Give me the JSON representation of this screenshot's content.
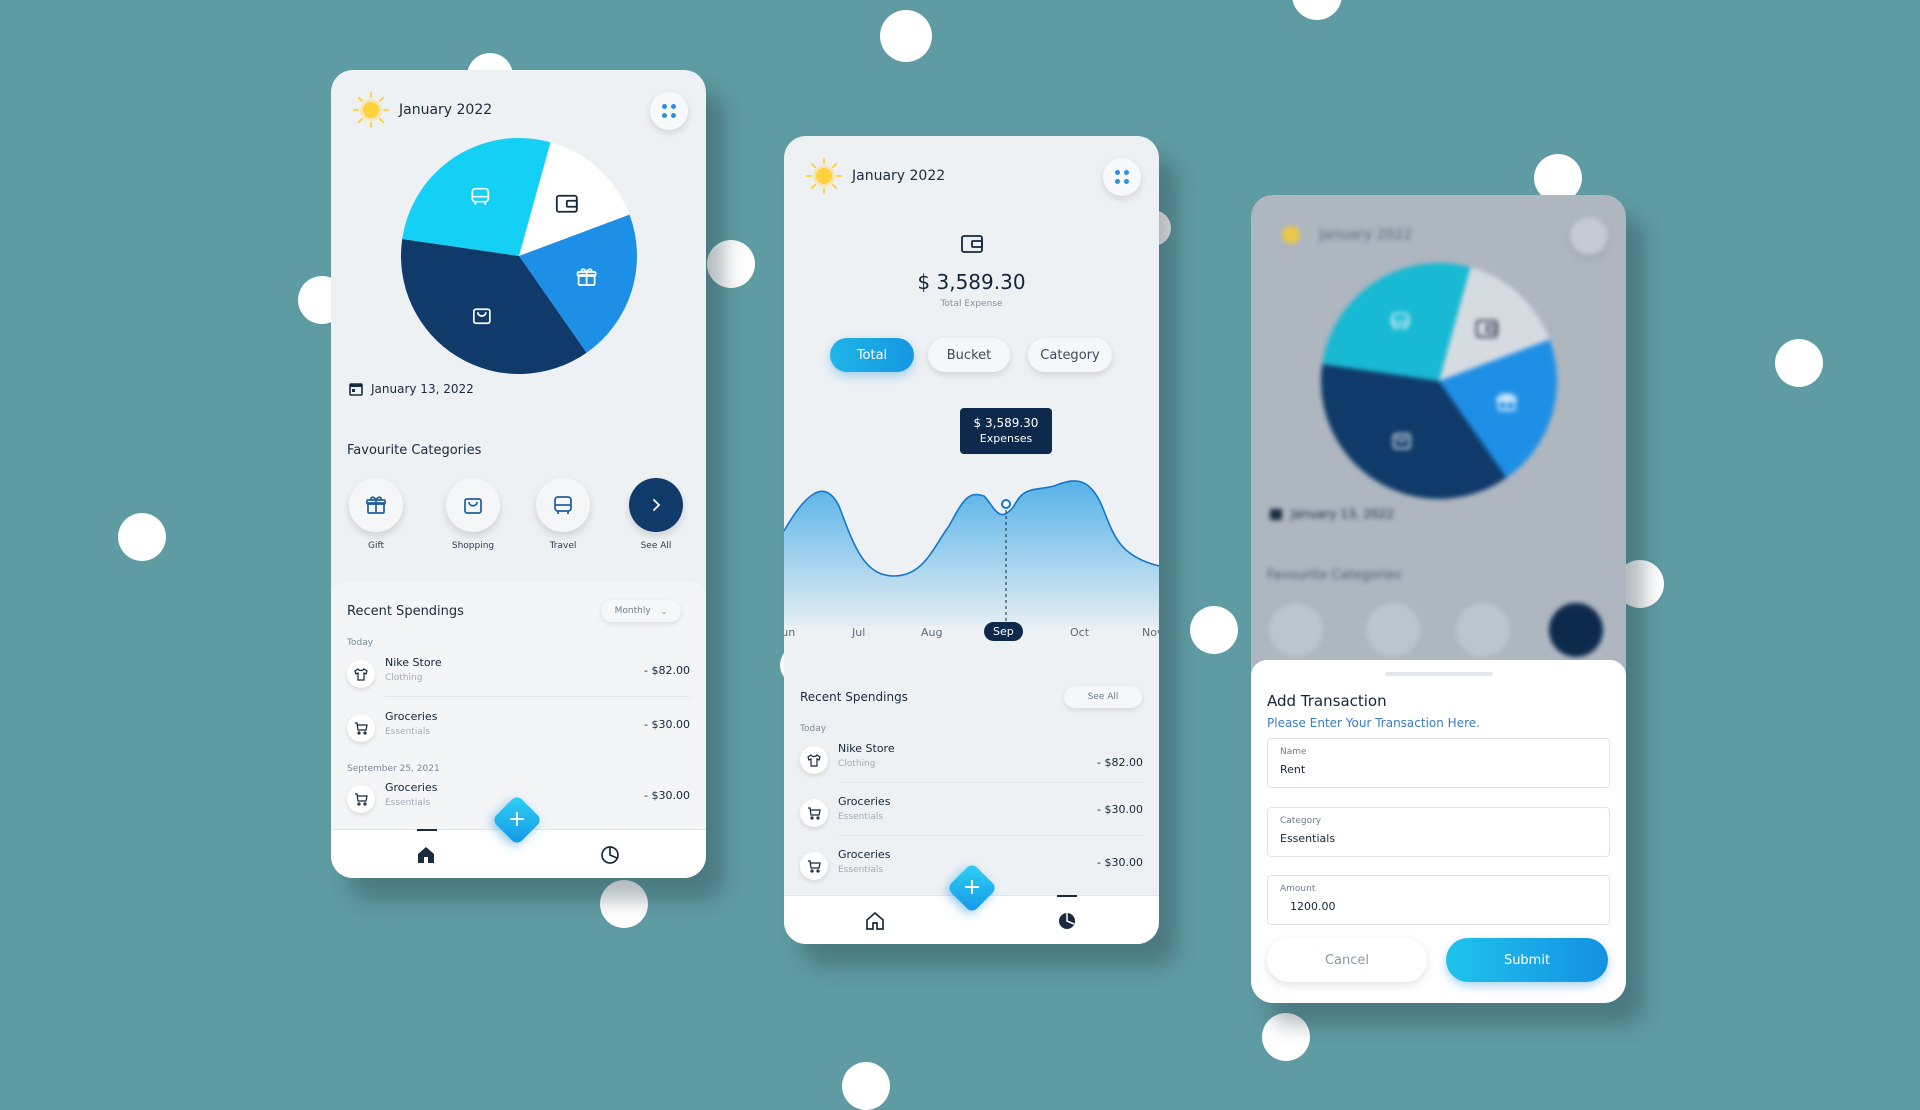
{
  "colors": {
    "background": "#5f9ba2",
    "navy": "#0d2a4d",
    "primary_blue": "#1595e6",
    "cyan": "#2fd3f5"
  },
  "screen1": {
    "month": "January 2022",
    "date": "January 13, 2022",
    "pie": {
      "slices": [
        {
          "name": "wallet",
          "icon": "wallet-icon",
          "value": 15,
          "color": "#ffffff"
        },
        {
          "name": "gift",
          "icon": "gift-icon",
          "value": 21,
          "color": "#1e8fe6"
        },
        {
          "name": "shopping",
          "icon": "shopping-bag-icon",
          "value": 37,
          "color": "#0f3a69"
        },
        {
          "name": "travel",
          "icon": "bus-icon",
          "value": 27,
          "color": "#15d0f5"
        }
      ]
    },
    "favourites_title": "Favourite Categories",
    "favourites": [
      {
        "label": "Gift",
        "icon": "gift-icon"
      },
      {
        "label": "Shopping",
        "icon": "shopping-bag-icon"
      },
      {
        "label": "Travel",
        "icon": "bus-icon"
      },
      {
        "label": "See All",
        "icon": "chevron-right-icon"
      }
    ],
    "recent_title": "Recent Spendings",
    "filter": "Monthly",
    "groups": [
      {
        "day": "Today"
      },
      {
        "day": "September 25, 2021"
      }
    ],
    "transactions": [
      {
        "name": "Nike Store",
        "category": "Clothing",
        "amount": "- $82.00",
        "icon": "shirt-icon"
      },
      {
        "name": "Groceries",
        "category": "Essentials",
        "amount": "- $30.00",
        "icon": "cart-icon"
      },
      {
        "name": "Groceries",
        "category": "Essentials",
        "amount": "- $30.00",
        "icon": "cart-icon"
      }
    ],
    "fab": "+"
  },
  "screen2": {
    "month": "January 2022",
    "total_amount": "$ 3,589.30",
    "total_label": "Total Expense",
    "segments": [
      "Total",
      "Bucket",
      "Category"
    ],
    "active_segment": "Total",
    "tooltip": {
      "amount": "$ 3,589.30",
      "label": "Expenses"
    },
    "months": [
      "Jun",
      "Jul",
      "Aug",
      "Sep",
      "Oct",
      "Nov"
    ],
    "selected_month": "Sep",
    "recent_title": "Recent Spendings",
    "see_all": "See All",
    "day": "Today",
    "transactions": [
      {
        "name": "Nike Store",
        "category": "Clothing",
        "amount": "- $82.00",
        "icon": "shirt-icon"
      },
      {
        "name": "Groceries",
        "category": "Essentials",
        "amount": "- $30.00",
        "icon": "cart-icon"
      },
      {
        "name": "Groceries",
        "category": "Essentials",
        "amount": "- $30.00",
        "icon": "cart-icon"
      }
    ],
    "fab": "+"
  },
  "screen3": {
    "bg_month": "January 2022",
    "bg_date": "January 13, 2022",
    "bg_favourites_title": "Favourite Categories",
    "sheet_title": "Add Transaction",
    "sheet_subtitle": "Please Enter Your Transaction Here.",
    "fields": [
      {
        "label": "Name",
        "value": "Rent"
      },
      {
        "label": "Category",
        "value": "Essentials"
      },
      {
        "label": "Amount",
        "value": "1200.00"
      }
    ],
    "cancel": "Cancel",
    "submit": "Submit"
  }
}
